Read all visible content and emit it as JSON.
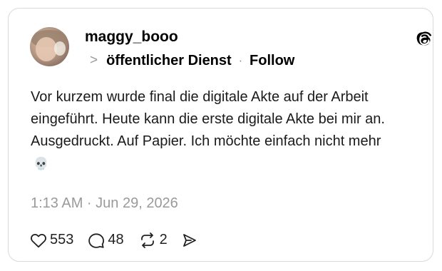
{
  "post": {
    "username": "maggy_booo",
    "community": "öffentlicher Dienst",
    "separator": "·",
    "follow_label": "Follow",
    "text": "Vor kurzem wurde final die digitale Akte auf der Arbeit eingeführt. Heute kann die erste digitale Akte bei mir an. Ausgedruckt. Auf Papier. Ich möchte einfach nicht mehr",
    "emoji": "💀",
    "timestamp": "1:13 AM · Jun 29, 2026",
    "likes": "553",
    "replies": "48",
    "reposts": "2"
  },
  "icons": {
    "brand": "threads-logo-icon",
    "chevron": "chevron-right-icon",
    "like": "heart-icon",
    "reply": "comment-bubble-icon",
    "repost": "repost-icon",
    "share": "send-icon"
  },
  "colors": {
    "text": "#1a1a1a",
    "muted": "#9a9a9a",
    "border": "#d9d9d9"
  }
}
